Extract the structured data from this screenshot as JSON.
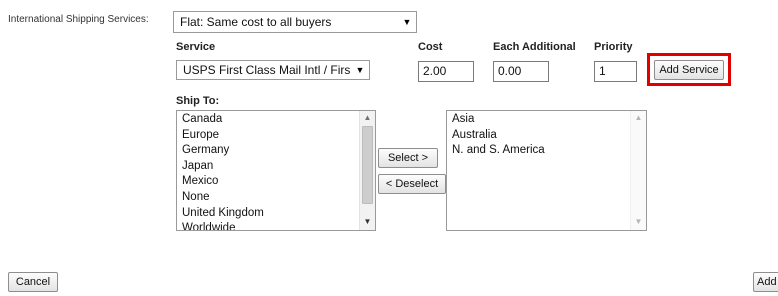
{
  "intl_label": "International Shipping Services:",
  "shipping_type": {
    "selected": "Flat: Same cost to all buyers"
  },
  "headers": {
    "service": "Service",
    "cost": "Cost",
    "each_additional": "Each Additional",
    "priority": "Priority",
    "ship_to": "Ship To:"
  },
  "service_select": {
    "selected": "USPS First Class Mail Intl / Firs"
  },
  "cost_value": "2.00",
  "each_additional_value": "0.00",
  "priority_value": "1",
  "buttons": {
    "add_service": "Add Service",
    "select": "Select >",
    "deselect": "< Deselect",
    "cancel": "Cancel",
    "add": "Add"
  },
  "available_locations": [
    "Canada",
    "Europe",
    "Germany",
    "Japan",
    "Mexico",
    "None",
    "United Kingdom",
    "Worldwide"
  ],
  "selected_locations": [
    "Asia",
    "Australia",
    "N. and S. America"
  ],
  "colors": {
    "highlight": "#e00000"
  }
}
